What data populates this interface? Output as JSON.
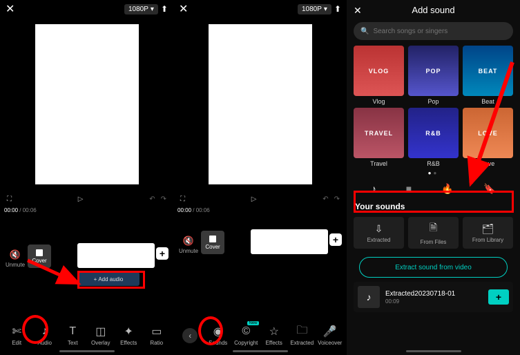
{
  "topbar": {
    "quality": "1080P"
  },
  "preview": {
    "timecode_current": "00:00",
    "timecode_total": "00:06",
    "unmute": "Unmute",
    "cover": "Cover",
    "add_audio": "Add audio"
  },
  "tools1": {
    "edit": "Edit",
    "audio": "Audio",
    "text": "Text",
    "overlay": "Overlay",
    "effects": "Effects",
    "ratio": "Ratio"
  },
  "tools2": {
    "new_badge": "New",
    "sounds": "Sounds",
    "copyright": "Copyright",
    "effects": "Effects",
    "extracted": "Extracted",
    "voiceover": "Voiceover"
  },
  "addSound": {
    "title": "Add sound",
    "search_placeholder": "Search songs or singers",
    "categories": [
      {
        "thumb": "VLOG",
        "label": "Vlog"
      },
      {
        "thumb": "POP",
        "label": "Pop"
      },
      {
        "thumb": "BEAT",
        "label": "Beat"
      },
      {
        "thumb": "TRAVEL",
        "label": "Travel"
      },
      {
        "thumb": "R&B",
        "label": "R&B"
      },
      {
        "thumb": "LOVE",
        "label": "Love"
      }
    ],
    "your_sounds_title": "Your sounds",
    "options": {
      "extracted": "Extracted",
      "from_files": "From Files",
      "from_library": "From Library"
    },
    "extract_btn": "Extract sound from video",
    "sound_item": {
      "name": "Extracted20230718-01",
      "duration": "00:09"
    }
  },
  "annot_color": "#ff0000"
}
